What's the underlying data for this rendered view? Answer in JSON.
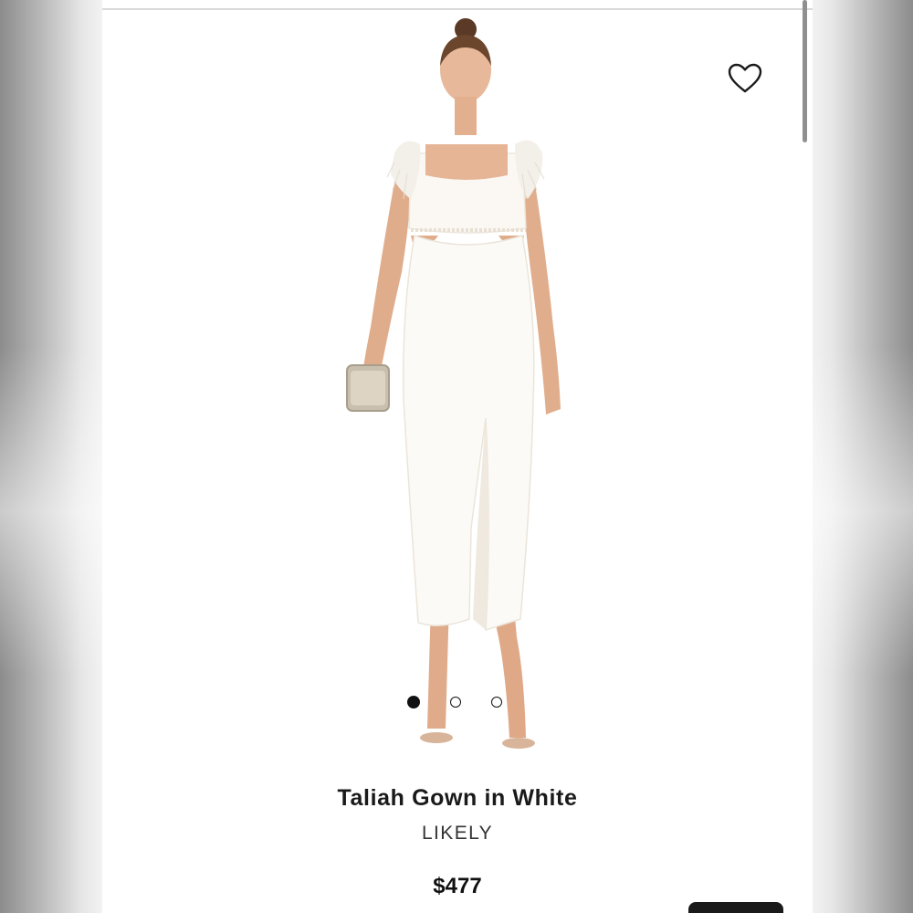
{
  "product": {
    "title": "Taliah Gown in White",
    "brand": "LIKELY",
    "price": "$477"
  },
  "gallery": {
    "image_count": 3,
    "active_index": 0
  },
  "icons": {
    "wishlist": "heart-outline-icon"
  },
  "colors": {
    "page_background": "#ffffff",
    "text_primary": "#1a1a1a",
    "dot_active": "#111111"
  }
}
